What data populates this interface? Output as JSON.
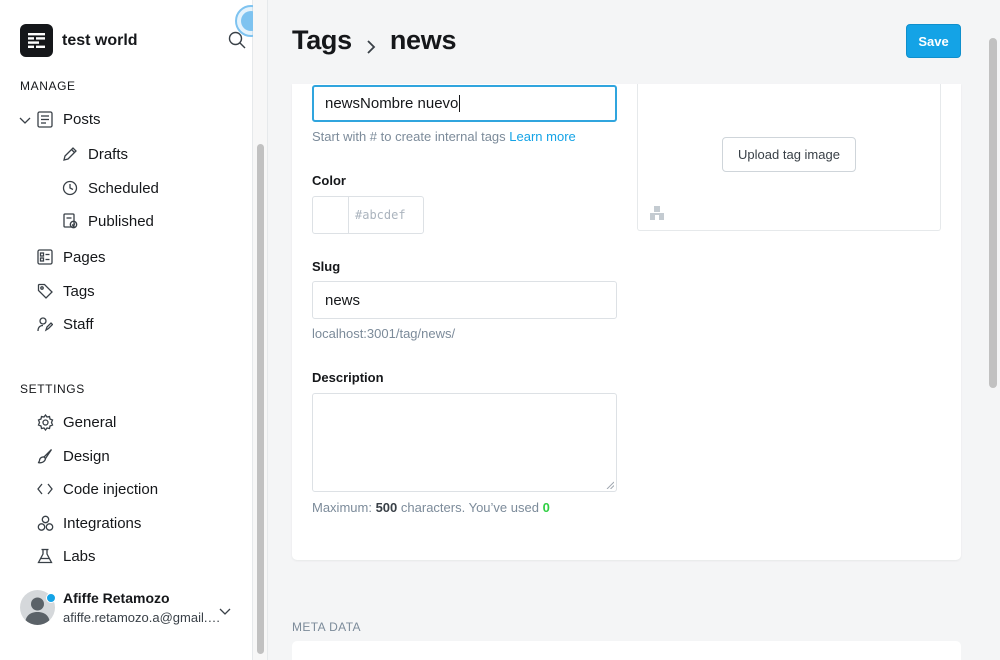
{
  "sidebar": {
    "site_name": "test world",
    "manage_title": "MANAGE",
    "settings_title": "SETTINGS",
    "manage_items": [
      {
        "label": "Posts"
      },
      {
        "label": "Drafts"
      },
      {
        "label": "Scheduled"
      },
      {
        "label": "Published"
      },
      {
        "label": "Pages"
      },
      {
        "label": "Tags"
      },
      {
        "label": "Staff"
      }
    ],
    "settings_items": [
      {
        "label": "General"
      },
      {
        "label": "Design"
      },
      {
        "label": "Code injection"
      },
      {
        "label": "Integrations"
      },
      {
        "label": "Labs"
      }
    ],
    "user": {
      "name": "Afiffe Retamozo",
      "email": "afiffe.retamozo.a@gmail.com"
    }
  },
  "header": {
    "breadcrumb_parent": "Tags",
    "breadcrumb_current": "news",
    "save_label": "Save"
  },
  "form": {
    "name_value": "newsNombre nuevo",
    "name_hint": "Start with # to create internal tags",
    "learn_more": "Learn more",
    "color_label": "Color",
    "color_placeholder": "#abcdef",
    "slug_label": "Slug",
    "slug_value": "news",
    "slug_url": "localhost:3001/tag/news/",
    "description_label": "Description",
    "counter_prefix": "Maximum:",
    "counter_max": "500",
    "counter_middle": "characters. You’ve used",
    "counter_used": "0",
    "upload_label": "Upload tag image"
  },
  "meta": {
    "title": "META DATA"
  },
  "colors": {
    "accent": "#14a3e6",
    "focus_border": "#30a5de",
    "counter_ok": "#30cf43"
  }
}
